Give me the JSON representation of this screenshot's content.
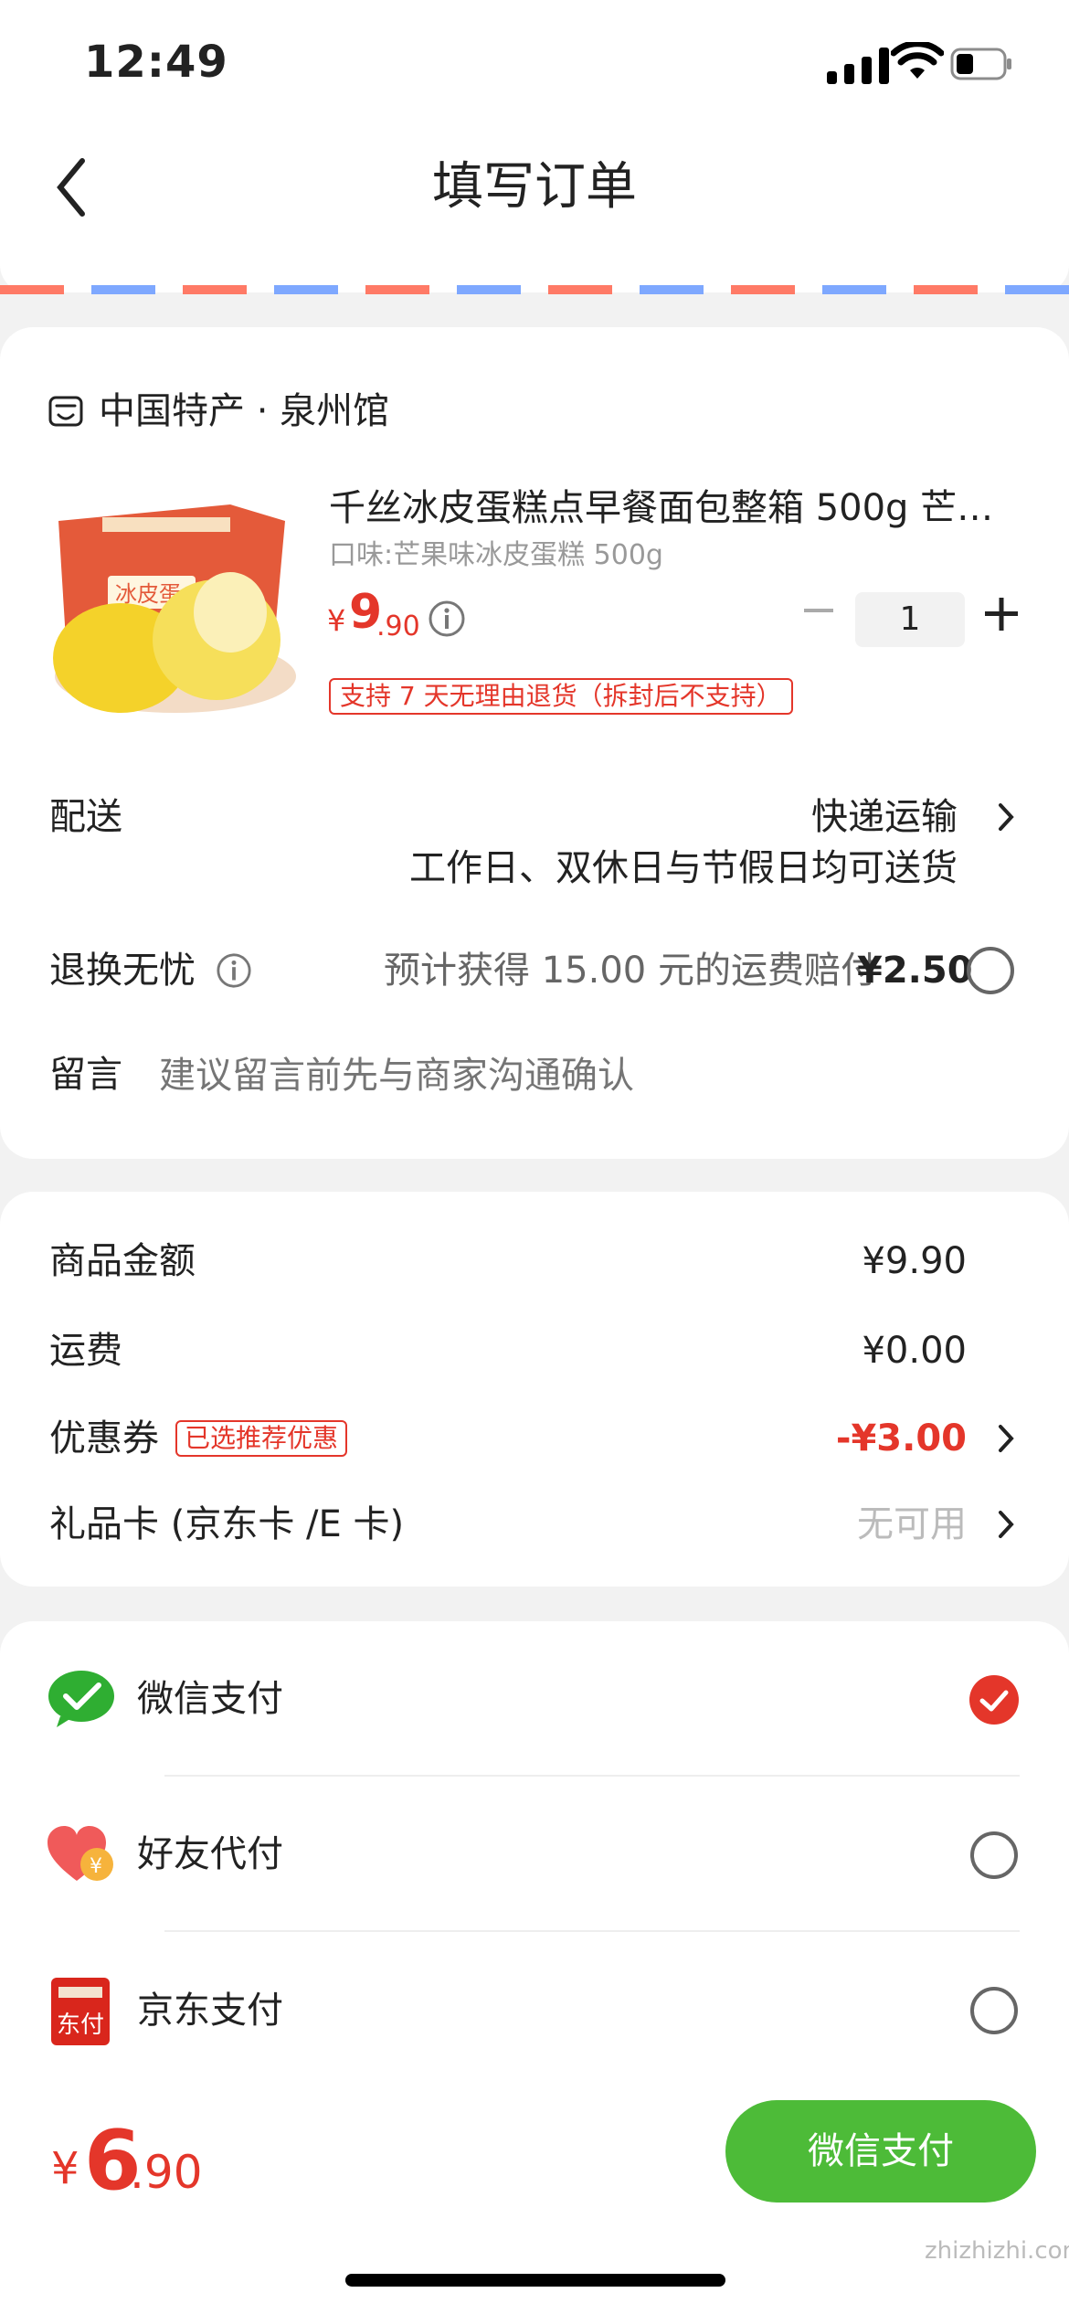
{
  "status_bar": {
    "time": "12:49"
  },
  "nav": {
    "title": "填写订单",
    "back_icon": "chevron-left-icon"
  },
  "shop": {
    "name": "中国特产 · 泉州馆",
    "icon": "shop-icon"
  },
  "product": {
    "title": "千丝冰皮蛋糕点早餐面包整箱 500g 芒果…",
    "spec": "口味:芒果味冰皮蛋糕 500g",
    "price_symbol": "¥",
    "price_int": "9",
    "price_dec": ".90",
    "quantity": "1",
    "return_policy": "支持 7 天无理由退货（拆封后不支持）",
    "image_box_text": "冰皮蛋"
  },
  "delivery": {
    "label": "配送",
    "method": "快递运输",
    "note": "工作日、双休日与节假日均可送货"
  },
  "worry_free": {
    "label": "退换无忧",
    "desc": "预计获得 15.00 元的运费赔付",
    "price": "¥2.50"
  },
  "message": {
    "label": "留言",
    "placeholder": "建议留言前先与商家沟通确认"
  },
  "summary": {
    "goods_label": "商品金额",
    "goods_value": "¥9.90",
    "shipping_label": "运费",
    "shipping_value": "¥0.00",
    "coupon_label": "优惠券",
    "coupon_badge": "已选推荐优惠",
    "coupon_value": "-¥3.00",
    "giftcard_label": "礼品卡 (京东卡 /E 卡)",
    "giftcard_value": "无可用"
  },
  "payment_methods": [
    {
      "name": "微信支付",
      "icon": "wechat-pay-icon",
      "selected": true
    },
    {
      "name": "好友代付",
      "icon": "friend-pay-heart-icon",
      "selected": false
    },
    {
      "name": "京东支付",
      "icon": "jd-pay-icon",
      "selected": false,
      "icon_text": "东付"
    }
  ],
  "bottom": {
    "total_symbol": "¥",
    "total_int": "6",
    "total_dec": ".90",
    "pay_button": "微信支付"
  },
  "watermark": "zhizhizhi.com",
  "colors": {
    "accent_red": "#e4362a",
    "wechat_green": "#4dbb38"
  }
}
